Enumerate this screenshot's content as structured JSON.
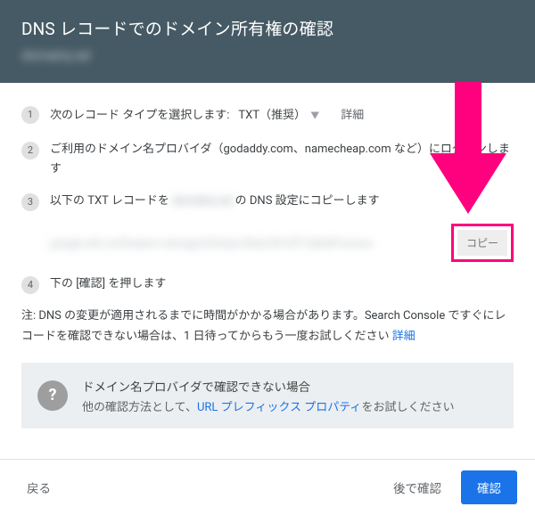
{
  "header": {
    "title": "DNS レコードでのドメイン所有権の確認",
    "domain_placeholder": "domainy.ad"
  },
  "steps": {
    "s1": {
      "num": "1",
      "text": "次のレコード タイプを選択します:",
      "select_value": "TXT（推奨）",
      "detail": "詳細"
    },
    "s2": {
      "num": "2",
      "text": "ご利用のドメイン名プロバイダ（godaddy.com、namecheap.com など）にログインします"
    },
    "s3": {
      "num": "3",
      "pre": "以下の TXT レコードを ",
      "blur": "domainy ad",
      "post": " の DNS 設定にコピーします"
    },
    "s4": {
      "num": "4",
      "text": "下の [確認] を押します"
    }
  },
  "txt_record": {
    "value_placeholder": "google-site-verification=ubmgxj1Kt2dsy-WtaUr5PvZFTu8hdPrxxxxxx",
    "copy_label": "コピー"
  },
  "note": {
    "text": "注: DNS の変更が適用されるまでに時間がかかる場合があります。Search Console ですぐにレコードを確認できない場合は、1 日待ってからもう一度お試しください ",
    "link": "詳細"
  },
  "alt": {
    "q": "?",
    "title": "ドメイン名プロバイダで確認できない場合",
    "body_pre": "他の確認方法として、",
    "link": "URL プレフィックス プロパティ",
    "body_post": "をお試しください"
  },
  "footer": {
    "back": "戻る",
    "later": "後で確認",
    "confirm": "確認"
  }
}
